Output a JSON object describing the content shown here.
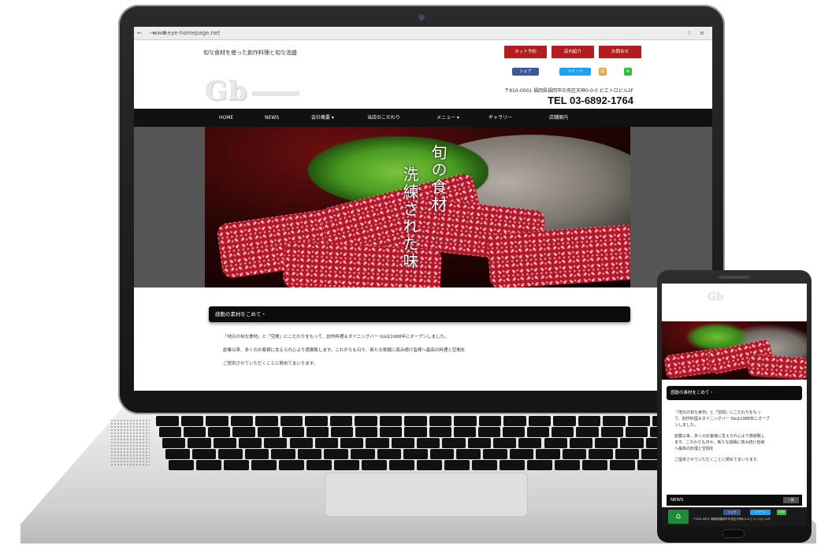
{
  "browser": {
    "url": "www.eye-homepage.net",
    "nav_icons": "← → ⟳",
    "toolbar_icons": "☆ ≡"
  },
  "site": {
    "tagline": "旬な食材を使った創作料理と旬な泡盛",
    "header_buttons": [
      "ネット予約",
      "店内紹介",
      "お問合せ"
    ],
    "social": {
      "share": "シェア",
      "tweet": "ツイート",
      "line": "LINE"
    },
    "logo": "Gb",
    "address": "〒810-0001 福岡県福岡市中央区天神0-0-0 ビエトロビル2F",
    "tel": "TEL 03-6892-1764",
    "nav": [
      "HOME",
      "NEWS",
      "会社概要 ▾",
      "当店のこだわり",
      "メニュー ▾",
      "ギャラリー",
      "店舗案内"
    ],
    "hero_caption_1": "旬の食材",
    "hero_caption_2": "洗練された味",
    "section_title": "感動の素材をこめて・",
    "paragraphs": [
      "「地元の旬な食材」と「空間」にこだわりをもって、創作料理＆ダイニングバー Gbは1988年にオープンしました。",
      "創業以来、多くのお客様に支えられ心より感謝致します。これからも日々、新たな挑戦に真み続け皆様へ最高の料理と空間を",
      "ご提供させていただくことに努めてまいります。"
    ]
  },
  "phone": {
    "logo": "Gb",
    "section_title": "感動の素材をこめて・",
    "paragraphs": [
      "「地元の旬な食材」と「空間」にこだわりをもっ",
      "て、創作料理＆ダイニングバー Gbは1988年にオープ",
      "ンしました。",
      "創業以来、多くのお客様に支えられ心より感謝致し",
      "ます。これからも日々、新たな挑戦に真み続け皆様",
      "へ最高の料理と空間を",
      "ご提供させていただくことに努めてまいります。"
    ],
    "news_label": "NEWS",
    "news_more": "一覧",
    "footer_text": "〒810-0001 福岡県福岡市中央区天神0-0-0 ビエトロビル2F",
    "home_icon": "⌂"
  },
  "colors": {
    "accent": "#b41d1d",
    "nav_bg": "#111111",
    "facebook": "#3b5998",
    "twitter": "#1da1f2",
    "line": "#2dbf3a"
  }
}
